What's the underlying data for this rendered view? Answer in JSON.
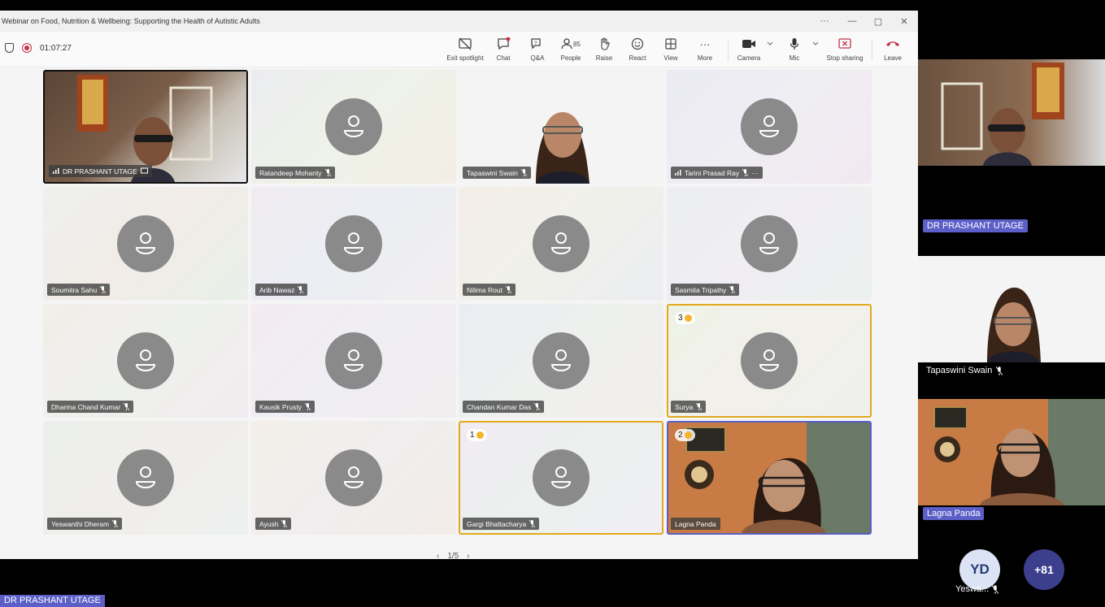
{
  "window": {
    "title": "Webinar on Food, Nutrition & Wellbeing: Supporting the Health of Autistic Adults",
    "more": "···",
    "minimize": "—",
    "restore": "▢",
    "close": "✕"
  },
  "toolbar": {
    "timer": "01:07:27",
    "exit_spotlight": "Exit spotlight",
    "chat": "Chat",
    "qa": "Q&A",
    "people": "People",
    "people_count": "85",
    "raise": "Raise",
    "react": "React",
    "view": "View",
    "more": "More",
    "camera": "Camera",
    "mic": "Mic",
    "stop_sharing": "Stop sharing",
    "leave": "Leave"
  },
  "participants": [
    {
      "name": "DR PRASHANT UTAGE",
      "type": "video"
    },
    {
      "name": "Ratandeep Mohanty",
      "type": "avatar"
    },
    {
      "name": "Tapaswini Swain",
      "type": "video"
    },
    {
      "name": "Tarini Prasad Ray",
      "type": "avatar"
    },
    {
      "name": "Soumitra Sahu",
      "type": "avatar"
    },
    {
      "name": "Arib Nawaz",
      "type": "avatar"
    },
    {
      "name": "Nilima Rout",
      "type": "avatar"
    },
    {
      "name": "Sasmita Tripathy",
      "type": "avatar"
    },
    {
      "name": "Dharma Chand Kumar",
      "type": "avatar"
    },
    {
      "name": "Kausik Prusty",
      "type": "avatar"
    },
    {
      "name": "Chandan Kumar Das",
      "type": "avatar"
    },
    {
      "name": "Surya",
      "type": "avatar",
      "hand_order": "3"
    },
    {
      "name": "Yeswanthi Dheram",
      "type": "avatar"
    },
    {
      "name": "Ayush",
      "type": "avatar"
    },
    {
      "name": "Gargi Bhattacharya",
      "type": "avatar",
      "hand_order": "1"
    },
    {
      "name": "Lagna Panda",
      "type": "video",
      "hand_order": "2"
    }
  ],
  "pager": {
    "label": "1/5",
    "prev": "‹",
    "next": "›"
  },
  "sidebar": {
    "tiles": [
      {
        "name": "DR PRASHANT UTAGE"
      },
      {
        "name": "Tapaswini Swain"
      },
      {
        "name": "Lagna Panda"
      }
    ],
    "overflow_initials": "YD",
    "overflow_name": "Yeswa...",
    "overflow_count": "+81"
  },
  "presenter_tag": "DR PRASHANT UTAGE",
  "colors": {
    "accent": "#5b5fc7",
    "hand_border": "#e3a81e",
    "recording": "#c4314b",
    "leave": "#c4314b"
  }
}
